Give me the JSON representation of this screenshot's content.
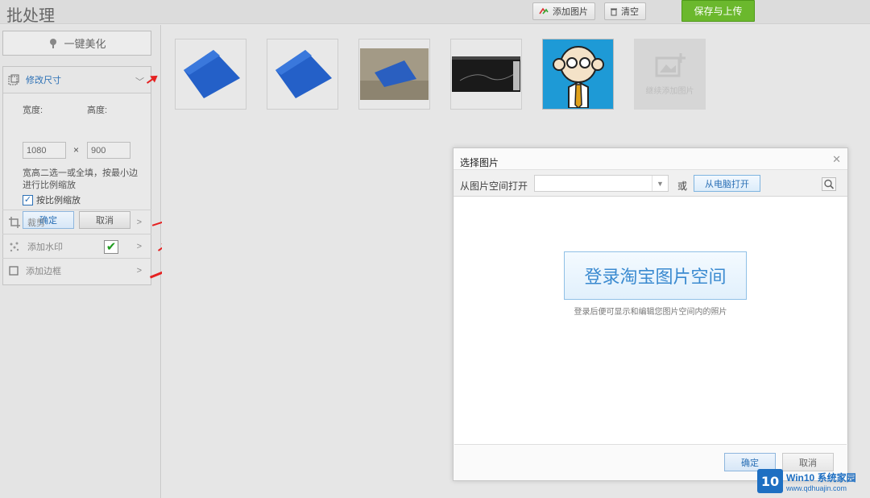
{
  "header": {
    "title": "批处理",
    "add_image": "添加图片",
    "clear": "清空",
    "save_upload": "保存与上传"
  },
  "sidebar": {
    "beautify": "一键美化",
    "resize": {
      "title": "修改尺寸",
      "width_label": "宽度:",
      "height_label": "高度:",
      "width_value": "1080",
      "height_value": "900",
      "hint": "宽高二选一或全填，按最小边进行比例缩放",
      "proportional": "按比例缩放",
      "ok": "确定",
      "cancel": "取消"
    },
    "tools": [
      {
        "label": "裁剪"
      },
      {
        "label": "添加水印"
      },
      {
        "label": "添加边框"
      }
    ]
  },
  "main": {
    "add_more": "继续添加图片"
  },
  "dialog": {
    "title": "选择图片",
    "open_from_space": "从图片空间打开",
    "or": "或",
    "open_from_pc": "从电脑打开",
    "login_button": "登录淘宝图片空间",
    "login_hint": "登录后便可显示和编辑您图片空间内的照片",
    "ok": "确定",
    "cancel": "取消"
  },
  "watermark": {
    "brand": "Win10 系统家园",
    "url": "www.qdhuajin.com",
    "badge": "10"
  },
  "colors": {
    "accent_blue": "#2a6fb5",
    "save_green": "#6bb82d",
    "arrow_red": "#e52222"
  }
}
